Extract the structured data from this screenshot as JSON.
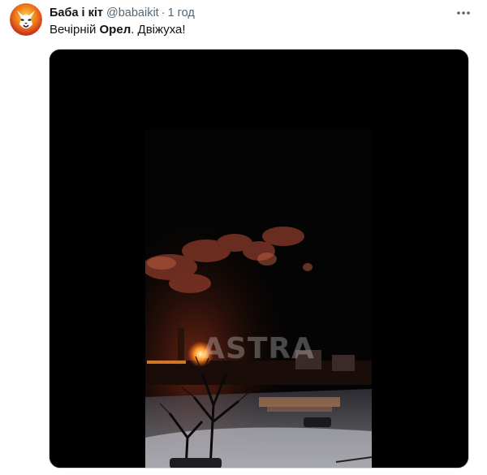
{
  "tweet": {
    "author_name": "Баба і кіт",
    "handle": "@babaikit",
    "separator": "·",
    "time": "1 год",
    "text_prefix": "Вечірній ",
    "text_bold": "Орел",
    "text_suffix": ". Двіжуха!"
  },
  "media": {
    "watermark": "ASTRA"
  },
  "colors": {
    "name": "#0f1419",
    "meta": "#536471",
    "media_bg": "#000000",
    "fire": "#ff8a2a"
  },
  "icons": {
    "more": "more-horizontal-icon",
    "avatar": "cat-mask-avatar"
  }
}
